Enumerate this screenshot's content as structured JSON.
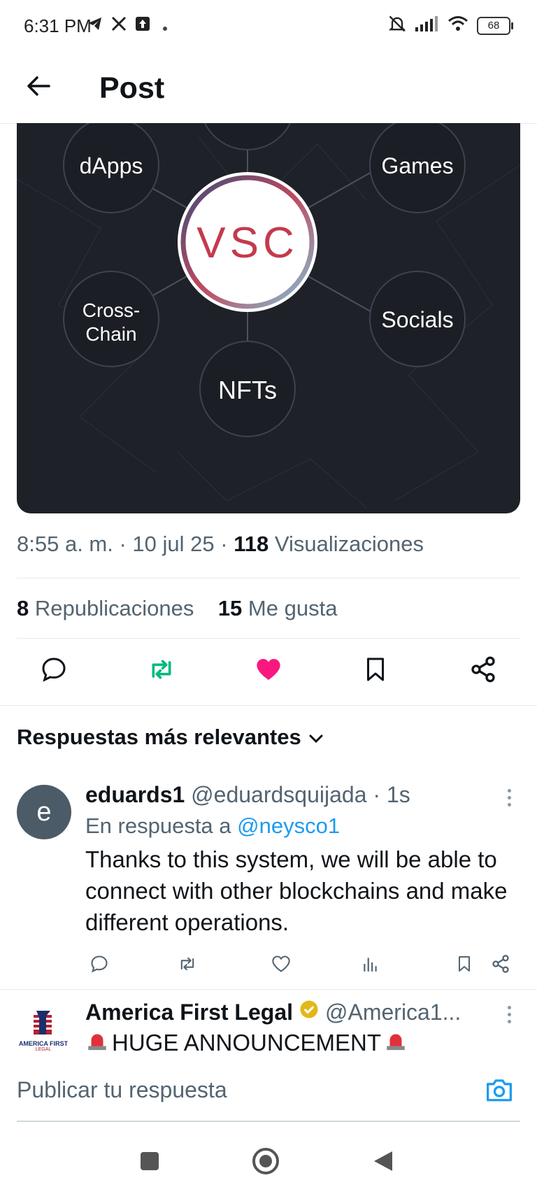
{
  "status_bar": {
    "time": "6:31 PM",
    "battery": "68",
    "icons": [
      "telegram-icon",
      "x-icon",
      "upload-icon",
      "dot-icon",
      "mute-bell-icon",
      "signal-icon",
      "wifi-icon",
      "battery-icon"
    ]
  },
  "header": {
    "title": "Post",
    "back_icon": "arrow-left-icon"
  },
  "media": {
    "center_label": "VSC",
    "nodes": [
      "dApps",
      "Games",
      "Cross-Chain",
      "Socials",
      "NFTs"
    ]
  },
  "post_meta": {
    "time": "8:55 a. m.",
    "date": "10 jul 25",
    "views_count": "118",
    "views_label": "Visualizaciones",
    "reposts_count": "8",
    "reposts_label": "Republicaciones",
    "likes_count": "15",
    "likes_label": "Me gusta"
  },
  "actions": [
    {
      "icon": "reply-icon"
    },
    {
      "icon": "repost-icon",
      "color": "#00ba7c"
    },
    {
      "icon": "heart-icon",
      "color": "#f91880"
    },
    {
      "icon": "bookmark-icon"
    },
    {
      "icon": "share-icon"
    }
  ],
  "replies_section": {
    "sort_label": "Respuestas más relevantes"
  },
  "reply": {
    "avatar_letter": "e",
    "name": "eduards1",
    "handle": "@eduardsquijada",
    "time": "1s",
    "in_reply_to_label": "En respuesta a",
    "mention": "@neysco1",
    "text": "Thanks to this system, we will be able to connect with other blockchains and make different operations."
  },
  "next_post": {
    "name": "America First Legal",
    "handle": "@America1...",
    "text": "HUGE ANNOUNCEMENT",
    "logo_text": "AMERICA FIRST",
    "logo_subtext": "LEGAL"
  },
  "composer": {
    "placeholder": "Publicar tu respuesta"
  },
  "colors": {
    "accent": "#1d9bf0",
    "repost_green": "#00ba7c",
    "like_pink": "#f91880",
    "secondary_text": "#536471",
    "media_bg": "#1e2128"
  }
}
